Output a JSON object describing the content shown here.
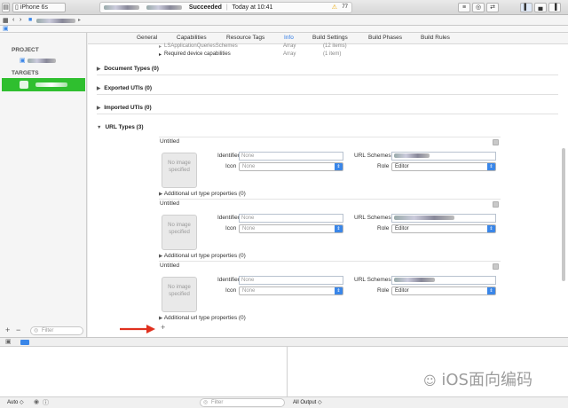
{
  "toolbar": {
    "device": "iPhone 6s",
    "status_result": "Succeeded",
    "status_time": "Today at 10:41",
    "warning_count": "77"
  },
  "sidebar": {
    "project_header": "PROJECT",
    "targets_header": "TARGETS",
    "filter_placeholder": "Filter",
    "add_label": "+",
    "remove_label": "−"
  },
  "settings_tabs": [
    "General",
    "Capabilities",
    "Resource Tags",
    "Info",
    "Build Settings",
    "Build Phases",
    "Build Rules"
  ],
  "selected_tab": "Info",
  "plist_rows": [
    {
      "key": "LSApplicationQueriesSchemes",
      "type": "Array",
      "value": "(12 items)"
    },
    {
      "key": "Required device capabilities",
      "type": "Array",
      "value": "(1 item)"
    }
  ],
  "sections": {
    "document_types": "Document Types (0)",
    "exported_utis": "Exported UTIs (0)",
    "imported_utis": "Imported UTIs (0)",
    "url_types": "URL Types (3)"
  },
  "url_type_labels": {
    "untitled": "Untitled",
    "identifier": "Identifier",
    "icon": "Icon",
    "url_schemes": "URL Schemes",
    "role": "Role",
    "no_image": "No image specified",
    "additional": "Additional url type properties (0)",
    "placeholder_name": "None",
    "role_value": "Editor"
  },
  "add_url_type": "+",
  "debug": {
    "auto_label": "Auto ◇",
    "filter_placeholder": "Filter",
    "output_label": "All Output ◇"
  },
  "watermark": "iOS面向编码",
  "colors": {
    "accent": "#3a86e8",
    "target_selected": "#2fbf2f",
    "arrow": "#e0301e"
  }
}
